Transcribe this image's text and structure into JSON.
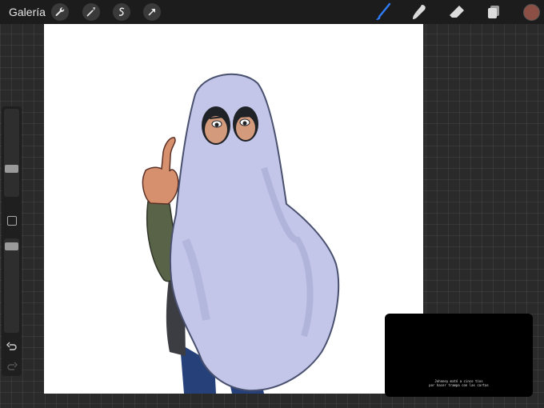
{
  "topbar": {
    "gallery_label": "Galería",
    "left_tools": [
      "wrench-icon",
      "magic-wand-icon",
      "selection-icon",
      "transform-arrow-icon"
    ],
    "right_tools": [
      "brush-icon",
      "smudge-icon",
      "eraser-icon",
      "layers-icon"
    ],
    "active_tool": "brush",
    "accent_color": "#2e7cf6",
    "current_color": "#8b4f45"
  },
  "sidebar": {
    "brush_size": 0.3,
    "opacity": 0.15
  },
  "caption_popup": {
    "line1": "Johnney mató a cinco tíos",
    "line2": "por hacer trampa con las cartas"
  }
}
